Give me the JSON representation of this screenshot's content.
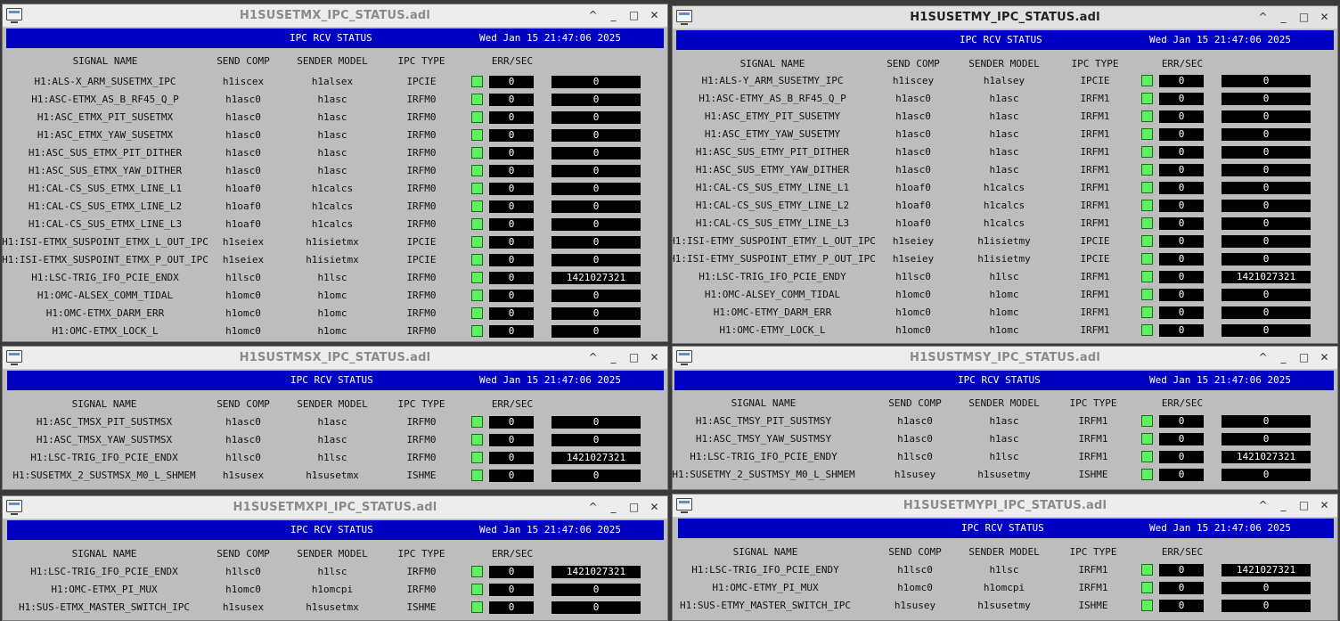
{
  "common": {
    "header_label": "IPC RCV STATUS",
    "header_date": "Wed Jan 15 21:47:06 2025",
    "columns": [
      "SIGNAL NAME",
      "SEND COMP",
      "SENDER MODEL",
      "IPC TYPE",
      "ERR/SEC"
    ],
    "window_buttons": [
      "^",
      "_",
      "□",
      "✕"
    ]
  },
  "windows": [
    {
      "title": "H1SUSETMX_IPC_STATUS.adl",
      "rows": [
        {
          "signal": "H1:ALS-X_ARM_SUSETMX_IPC",
          "comp": "h1iscex",
          "model": "h1alsex",
          "type": "IPCIE",
          "err": "0",
          "val": "0"
        },
        {
          "signal": "H1:ASC-ETMX_AS_B_RF45_Q_P",
          "comp": "h1asc0",
          "model": "h1asc",
          "type": "IRFM0",
          "err": "0",
          "val": "0"
        },
        {
          "signal": "H1:ASC_ETMX_PIT_SUSETMX",
          "comp": "h1asc0",
          "model": "h1asc",
          "type": "IRFM0",
          "err": "0",
          "val": "0"
        },
        {
          "signal": "H1:ASC_ETMX_YAW_SUSETMX",
          "comp": "h1asc0",
          "model": "h1asc",
          "type": "IRFM0",
          "err": "0",
          "val": "0"
        },
        {
          "signal": "H1:ASC_SUS_ETMX_PIT_DITHER",
          "comp": "h1asc0",
          "model": "h1asc",
          "type": "IRFM0",
          "err": "0",
          "val": "0"
        },
        {
          "signal": "H1:ASC_SUS_ETMX_YAW_DITHER",
          "comp": "h1asc0",
          "model": "h1asc",
          "type": "IRFM0",
          "err": "0",
          "val": "0"
        },
        {
          "signal": "H1:CAL-CS_SUS_ETMX_LINE_L1",
          "comp": "h1oaf0",
          "model": "h1calcs",
          "type": "IRFM0",
          "err": "0",
          "val": "0"
        },
        {
          "signal": "H1:CAL-CS_SUS_ETMX_LINE_L2",
          "comp": "h1oaf0",
          "model": "h1calcs",
          "type": "IRFM0",
          "err": "0",
          "val": "0"
        },
        {
          "signal": "H1:CAL-CS_SUS_ETMX_LINE_L3",
          "comp": "h1oaf0",
          "model": "h1calcs",
          "type": "IRFM0",
          "err": "0",
          "val": "0"
        },
        {
          "signal": "H1:ISI-ETMX_SUSPOINT_ETMX_L_OUT_IPC",
          "comp": "h1seiex",
          "model": "h1isietmx",
          "type": "IPCIE",
          "err": "0",
          "val": "0"
        },
        {
          "signal": "H1:ISI-ETMX_SUSPOINT_ETMX_P_OUT_IPC",
          "comp": "h1seiex",
          "model": "h1isietmx",
          "type": "IPCIE",
          "err": "0",
          "val": "0"
        },
        {
          "signal": "H1:LSC-TRIG_IFO_PCIE_ENDX",
          "comp": "h1lsc0",
          "model": "h1lsc",
          "type": "IRFM0",
          "err": "0",
          "val": "1421027321"
        },
        {
          "signal": "H1:OMC-ALSEX_COMM_TIDAL",
          "comp": "h1omc0",
          "model": "h1omc",
          "type": "IRFM0",
          "err": "0",
          "val": "0"
        },
        {
          "signal": "H1:OMC-ETMX_DARM_ERR",
          "comp": "h1omc0",
          "model": "h1omc",
          "type": "IRFM0",
          "err": "0",
          "val": "0"
        },
        {
          "signal": "H1:OMC-ETMX_LOCK_L",
          "comp": "h1omc0",
          "model": "h1omc",
          "type": "IRFM0",
          "err": "0",
          "val": "0"
        }
      ]
    },
    {
      "title": "H1SUSETMY_IPC_STATUS.adl",
      "rows": [
        {
          "signal": "H1:ALS-Y_ARM_SUSETMY_IPC",
          "comp": "h1iscey",
          "model": "h1alsey",
          "type": "IPCIE",
          "err": "0",
          "val": "0"
        },
        {
          "signal": "H1:ASC-ETMY_AS_B_RF45_Q_P",
          "comp": "h1asc0",
          "model": "h1asc",
          "type": "IRFM1",
          "err": "0",
          "val": "0"
        },
        {
          "signal": "H1:ASC_ETMY_PIT_SUSETMY",
          "comp": "h1asc0",
          "model": "h1asc",
          "type": "IRFM1",
          "err": "0",
          "val": "0"
        },
        {
          "signal": "H1:ASC_ETMY_YAW_SUSETMY",
          "comp": "h1asc0",
          "model": "h1asc",
          "type": "IRFM1",
          "err": "0",
          "val": "0"
        },
        {
          "signal": "H1:ASC_SUS_ETMY_PIT_DITHER",
          "comp": "h1asc0",
          "model": "h1asc",
          "type": "IRFM1",
          "err": "0",
          "val": "0"
        },
        {
          "signal": "H1:ASC_SUS_ETMY_YAW_DITHER",
          "comp": "h1asc0",
          "model": "h1asc",
          "type": "IRFM1",
          "err": "0",
          "val": "0"
        },
        {
          "signal": "H1:CAL-CS_SUS_ETMY_LINE_L1",
          "comp": "h1oaf0",
          "model": "h1calcs",
          "type": "IRFM1",
          "err": "0",
          "val": "0"
        },
        {
          "signal": "H1:CAL-CS_SUS_ETMY_LINE_L2",
          "comp": "h1oaf0",
          "model": "h1calcs",
          "type": "IRFM1",
          "err": "0",
          "val": "0"
        },
        {
          "signal": "H1:CAL-CS_SUS_ETMY_LINE_L3",
          "comp": "h1oaf0",
          "model": "h1calcs",
          "type": "IRFM1",
          "err": "0",
          "val": "0"
        },
        {
          "signal": "H1:ISI-ETMY_SUSPOINT_ETMY_L_OUT_IPC",
          "comp": "h1seiey",
          "model": "h1isietmy",
          "type": "IPCIE",
          "err": "0",
          "val": "0"
        },
        {
          "signal": "H1:ISI-ETMY_SUSPOINT_ETMY_P_OUT_IPC",
          "comp": "h1seiey",
          "model": "h1isietmy",
          "type": "IPCIE",
          "err": "0",
          "val": "0"
        },
        {
          "signal": "H1:LSC-TRIG_IFO_PCIE_ENDY",
          "comp": "h1lsc0",
          "model": "h1lsc",
          "type": "IRFM1",
          "err": "0",
          "val": "1421027321"
        },
        {
          "signal": "H1:OMC-ALSEY_COMM_TIDAL",
          "comp": "h1omc0",
          "model": "h1omc",
          "type": "IRFM1",
          "err": "0",
          "val": "0"
        },
        {
          "signal": "H1:OMC-ETMY_DARM_ERR",
          "comp": "h1omc0",
          "model": "h1omc",
          "type": "IRFM1",
          "err": "0",
          "val": "0"
        },
        {
          "signal": "H1:OMC-ETMY_LOCK_L",
          "comp": "h1omc0",
          "model": "h1omc",
          "type": "IRFM1",
          "err": "0",
          "val": "0"
        }
      ]
    },
    {
      "title": "H1SUSTMSX_IPC_STATUS.adl",
      "rows": [
        {
          "signal": "H1:ASC_TMSX_PIT_SUSTMSX",
          "comp": "h1asc0",
          "model": "h1asc",
          "type": "IRFM0",
          "err": "0",
          "val": "0"
        },
        {
          "signal": "H1:ASC_TMSX_YAW_SUSTMSX",
          "comp": "h1asc0",
          "model": "h1asc",
          "type": "IRFM0",
          "err": "0",
          "val": "0"
        },
        {
          "signal": "H1:LSC-TRIG_IFO_PCIE_ENDX",
          "comp": "h1lsc0",
          "model": "h1lsc",
          "type": "IRFM0",
          "err": "0",
          "val": "1421027321"
        },
        {
          "signal": "H1:SUSETMX_2_SUSTMSX_M0_L_SHMEM",
          "comp": "h1susex",
          "model": "h1susetmx",
          "type": "ISHME",
          "err": "0",
          "val": "0"
        }
      ]
    },
    {
      "title": "H1SUSTMSY_IPC_STATUS.adl",
      "rows": [
        {
          "signal": "H1:ASC_TMSY_PIT_SUSTMSY",
          "comp": "h1asc0",
          "model": "h1asc",
          "type": "IRFM1",
          "err": "0",
          "val": "0"
        },
        {
          "signal": "H1:ASC_TMSY_YAW_SUSTMSY",
          "comp": "h1asc0",
          "model": "h1asc",
          "type": "IRFM1",
          "err": "0",
          "val": "0"
        },
        {
          "signal": "H1:LSC-TRIG_IFO_PCIE_ENDY",
          "comp": "h1lsc0",
          "model": "h1lsc",
          "type": "IRFM1",
          "err": "0",
          "val": "1421027321"
        },
        {
          "signal": "H1:SUSETMY_2_SUSTMSY_M0_L_SHMEM",
          "comp": "h1susey",
          "model": "h1susetmy",
          "type": "ISHME",
          "err": "0",
          "val": "0"
        }
      ]
    },
    {
      "title": "H1SUSETMXPI_IPC_STATUS.adl",
      "rows": [
        {
          "signal": "H1:LSC-TRIG_IFO_PCIE_ENDX",
          "comp": "h1lsc0",
          "model": "h1lsc",
          "type": "IRFM0",
          "err": "0",
          "val": "1421027321"
        },
        {
          "signal": "H1:OMC-ETMX_PI_MUX",
          "comp": "h1omc0",
          "model": "h1omcpi",
          "type": "IRFM0",
          "err": "0",
          "val": "0"
        },
        {
          "signal": "H1:SUS-ETMX_MASTER_SWITCH_IPC",
          "comp": "h1susex",
          "model": "h1susetmx",
          "type": "ISHME",
          "err": "0",
          "val": "0"
        }
      ]
    },
    {
      "title": "H1SUSETMYPI_IPC_STATUS.adl",
      "rows": [
        {
          "signal": "H1:LSC-TRIG_IFO_PCIE_ENDY",
          "comp": "h1lsc0",
          "model": "h1lsc",
          "type": "IRFM1",
          "err": "0",
          "val": "1421027321"
        },
        {
          "signal": "H1:OMC-ETMY_PI_MUX",
          "comp": "h1omc0",
          "model": "h1omcpi",
          "type": "IRFM1",
          "err": "0",
          "val": "0"
        },
        {
          "signal": "H1:SUS-ETMY_MASTER_SWITCH_IPC",
          "comp": "h1susey",
          "model": "h1susetmy",
          "type": "ISHME",
          "err": "0",
          "val": "0"
        }
      ]
    }
  ],
  "colors": {
    "header_bg": "#0000c4",
    "ok_led": "#5ef05e",
    "panel_bg": "#bdbdbd",
    "value_bg": "#000000"
  }
}
